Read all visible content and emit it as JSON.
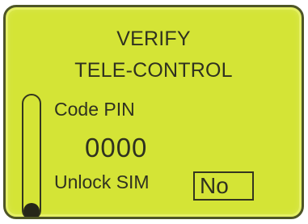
{
  "screen": {
    "title_line_1": "VERIFY",
    "title_line_2": "TELE-CONTROL",
    "code_pin_label": "Code PIN",
    "code_pin_value": "0000",
    "unlock_sim_label": "Unlock SIM",
    "unlock_sim_value": "No",
    "scroll_position": 1
  },
  "colors": {
    "lcd_background": "#d4e436",
    "lcd_text": "#2f3120",
    "border": "#4e5526"
  }
}
